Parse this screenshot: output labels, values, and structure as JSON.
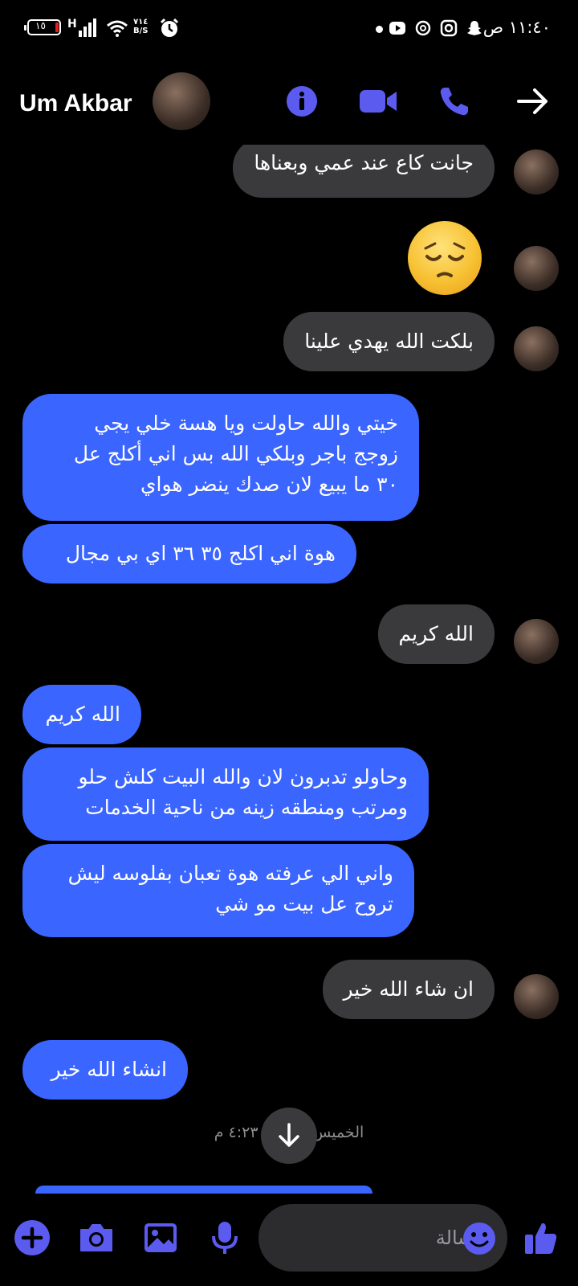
{
  "status_bar": {
    "time": "١١:٤٠ ص",
    "battery": "١٥",
    "network": "H",
    "speed_top": "٧١٤",
    "speed_bottom": "B/S"
  },
  "header": {
    "contact_name": "Um Akbar",
    "icons": [
      "info-icon",
      "video-call-icon",
      "phone-icon",
      "back-arrow-icon"
    ],
    "accent": "#5b5bf0"
  },
  "messages": [
    {
      "side": "in",
      "text": "جانت كاع عند عمي وبعناها"
    },
    {
      "side": "in",
      "emoji": "pensive-face"
    },
    {
      "side": "in",
      "text": "بلكت الله يهدي علينا"
    },
    {
      "side": "out",
      "lines": [
        "خيتي والله حاولت ويا هسة خلي يجي",
        "زوجج باجر وبلكي الله بس اني أكلج عل",
        "٣٠ ما يبيع لان صدك ينضر هواي"
      ]
    },
    {
      "side": "out",
      "text": "هوة اني اكلج ٣٥ ٣٦ اي بي مجال"
    },
    {
      "side": "in",
      "text": "الله كريم"
    },
    {
      "side": "out",
      "text": "الله كريم"
    },
    {
      "side": "out",
      "lines": [
        "وحاولو تدبرون لان والله البيت كلش حلو",
        "ومرتب ومنطقه زينه من ناحية الخدمات"
      ]
    },
    {
      "side": "out",
      "lines": [
        "واني الي عرفته هوة تعبان بفلوسه ليش",
        "تروح عل بيت مو شي"
      ]
    },
    {
      "side": "in",
      "text": "ان شاء الله خير"
    },
    {
      "side": "out",
      "text": "انشاء الله خير"
    }
  ],
  "timestamp": "الخميس الساعة ٤:٢٣ م",
  "composer": {
    "placeholder": "رسالة",
    "icons": [
      "add-icon",
      "camera-icon",
      "gallery-icon",
      "microphone-icon",
      "emoji-icon",
      "like-icon"
    ]
  },
  "colors": {
    "outgoing_bubble": "#3a65ff",
    "incoming_bubble": "#3a3a3c",
    "background": "#000000"
  }
}
